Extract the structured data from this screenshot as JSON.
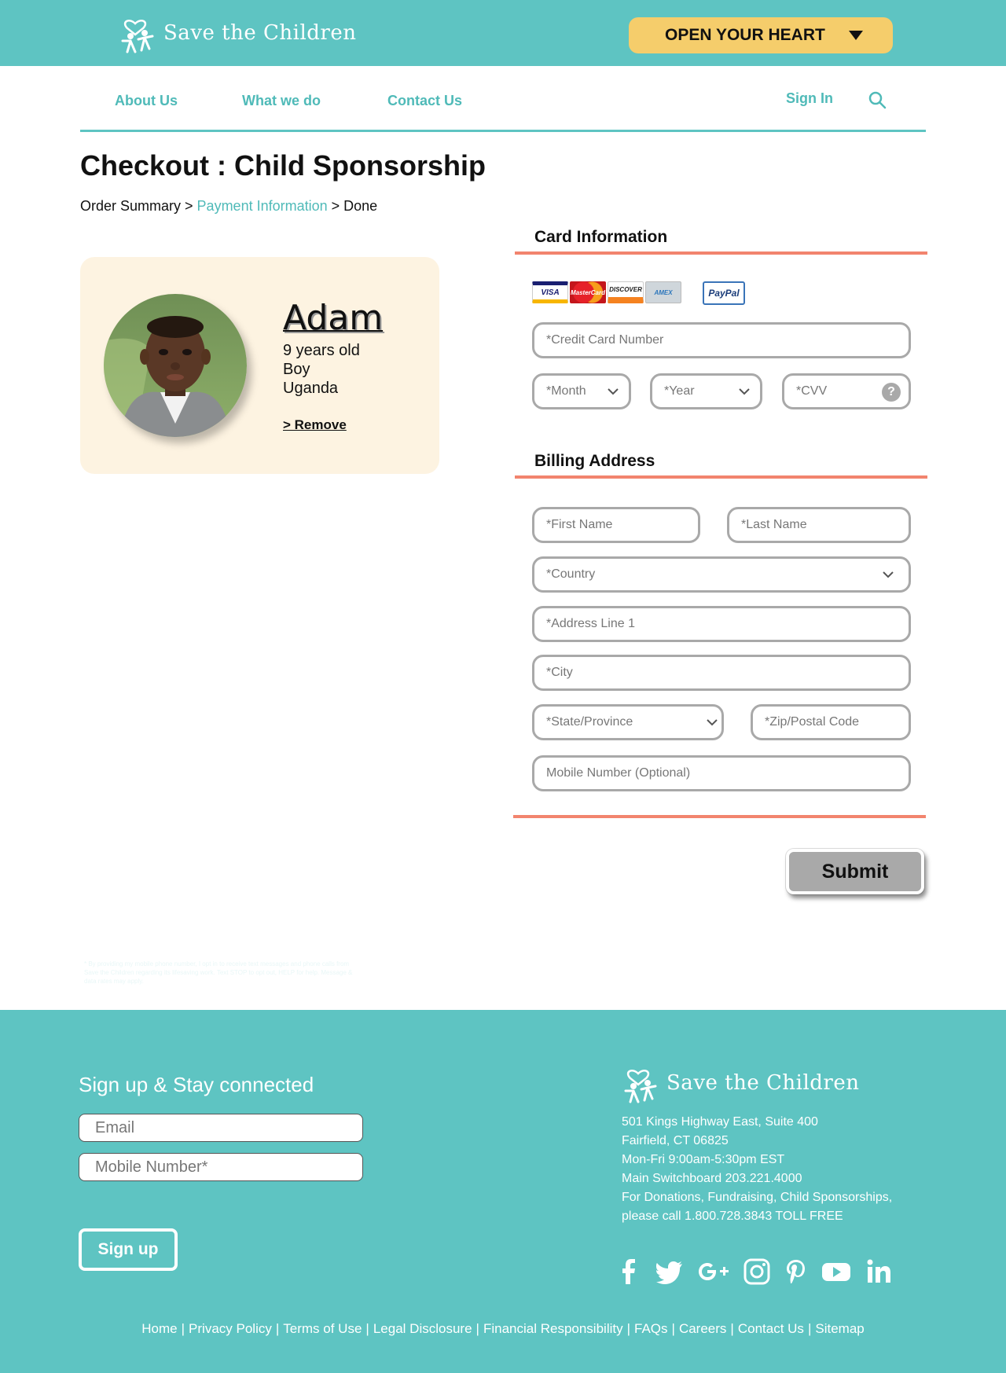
{
  "header": {
    "brand": "Save the Children",
    "cta_label": "OPEN YOUR HEART"
  },
  "nav": {
    "items": [
      "About Us",
      "What we do",
      "Contact Us"
    ],
    "signin": "Sign In"
  },
  "page": {
    "title": "Checkout : Child Sponsorship",
    "breadcrumb": {
      "step1": "Order Summary",
      "sep1": " > ",
      "step2": "Payment Information",
      "sep2": " > ",
      "step3": "Done"
    }
  },
  "child": {
    "name": "Adam",
    "age": "9 years old",
    "gender": "Boy",
    "country": "Uganda",
    "remove_label": "> Remove"
  },
  "card_section": {
    "title": "Card Information",
    "brands": [
      "VISA",
      "MasterCard",
      "DISCOVER",
      "AMEX"
    ],
    "paypal": "PayPal",
    "cc_placeholder": "*Credit Card Number",
    "month_placeholder": "*Month",
    "year_placeholder": "*Year",
    "cvv_placeholder": "*CVV",
    "help": "?"
  },
  "billing": {
    "title": "Billing Address",
    "first_name": "*First Name",
    "last_name": "*Last Name",
    "country": "*Country",
    "address1": "*Address Line 1",
    "city": "*City",
    "state": "*State/Province",
    "zip": "*Zip/Postal Code",
    "mobile": "Mobile Number (Optional)"
  },
  "submit_label": "Submit",
  "footer": {
    "signup_title": "Sign up & Stay connected",
    "email_placeholder": "Email",
    "mobile_placeholder": "Mobile Number*",
    "disclaimer": "* By providing my mobile phone number, I opt in to receive text messages and phone calls from Save the Children regarding its lifesaving work. Text STOP to opt out, HELP for help. Message & data rates may apply.",
    "signup_button": "Sign up",
    "brand": "Save the Children",
    "address": [
      "501 Kings Highway East, Suite 400",
      "Fairfield, CT 06825",
      "Mon-Fri 9:00am-5:30pm EST",
      "Main Switchboard 203.221.4000",
      "For Donations, Fundraising, Child Sponsorships,",
      "please call 1.800.728.3843 TOLL FREE"
    ],
    "social_icons": [
      "facebook-icon",
      "twitter-icon",
      "google-plus-icon",
      "instagram-icon",
      "pinterest-icon",
      "youtube-icon",
      "linkedin-icon"
    ],
    "links": [
      "Home",
      "Privacy Policy",
      "Terms of Use",
      "Legal Disclosure",
      "Financial Responsibility",
      "FAQs",
      "Careers",
      "Contact Us",
      "Sitemap"
    ],
    "link_separator": "|"
  },
  "colors": {
    "teal": "#5ec4c2",
    "teal_text": "#4fbab8",
    "cta_yellow": "#f5cd6b",
    "section_rule": "#f2846e",
    "card_bg": "#fdf3e1",
    "field_border": "#a9a9a9"
  }
}
